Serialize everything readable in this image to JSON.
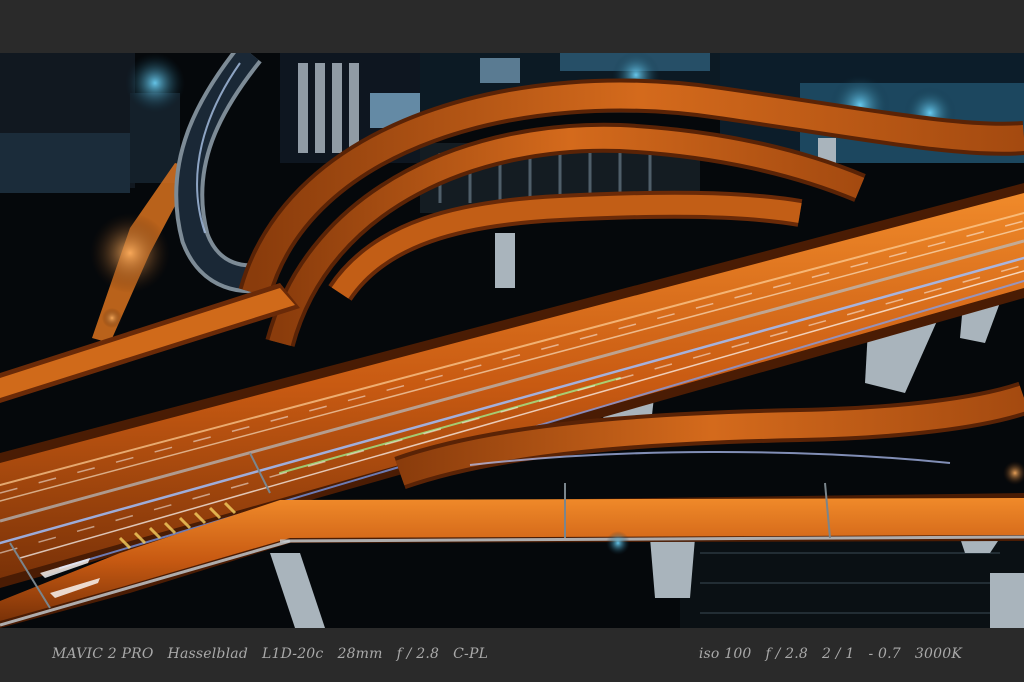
{
  "caption": {
    "camera": "MAVIC 2 PRO",
    "brand": "Hasselblad",
    "sensor": "L1D-20c",
    "focal_length": "28mm",
    "aperture_left": "f / 2.8",
    "filter": "C-PL",
    "iso": "iso 100",
    "aperture_right": "f / 2.8",
    "shutter": "2 / 1",
    "exposure_comp": "- 0.7",
    "white_balance": "3000K"
  },
  "colors": {
    "frame": "#2a2a2a",
    "caption_text": "#a9a9a9",
    "road_orange": "#e3721c",
    "light_trail_blue": "#8fb4ff",
    "light_trail_white": "#ffffff",
    "night_sky": "#06090c"
  }
}
